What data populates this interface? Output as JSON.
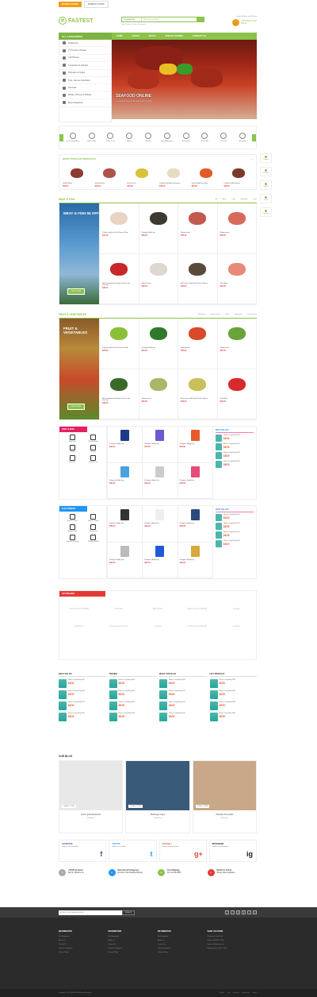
{
  "topbar": {
    "tab1": "MARKET STORE",
    "tab2": "MOMENT STORE"
  },
  "logo": {
    "text": "FASTEST"
  },
  "search": {
    "category": "All categories",
    "placeholder": "Enter the keyword",
    "icon": "search-icon",
    "tags": "Tags: Fashion, Clothes, Electronics"
  },
  "header": {
    "links": "Login  My Account  Wishlist",
    "cart_label": "SHOPPING CART",
    "cart_amount": "$00.00"
  },
  "nav": {
    "categories": "ALL CATEGORIES",
    "items": [
      "HOME",
      "PAGES",
      "DEALS",
      "SPECIAL OFFERS",
      "CONTACT US"
    ]
  },
  "sidebar": [
    "Appliances",
    "TV & Home Theater",
    "Cell Phones",
    "Computers & Laptops",
    "Television & Video",
    "Toys, Games & Hobbies",
    "Cameras",
    "Mobile, Phones & Tablets",
    "More categories"
  ],
  "banner": {
    "title": "SEAFOOD ONLINE",
    "subtitle": "a complete range of all fresh seafood online"
  },
  "categories": [
    "Fruit & Vegetables",
    "Meat & Fish",
    "Drinks & Tea",
    "Bakery",
    "Beauty",
    "Home Appliances",
    "Beverages",
    "Gift & Gifts",
    "Pet Care",
    "Household"
  ],
  "popular": {
    "title": "MOST POPULAR PRODUCTS",
    "items": [
      {
        "name": "Grilled Meat",
        "price": "$40.00",
        "color": "#8d3b2e"
      },
      {
        "name": "Sheep Head",
        "price": "$40.00",
        "color": "#b0514a"
      },
      {
        "name": "Fresh Fruit",
        "price": "$40.00",
        "color": "#d9c33c"
      },
      {
        "name": "Cepbate deletion elemmen",
        "price": "$40.00",
        "color": "#e8dcc0"
      },
      {
        "name": "Dart Deliberacy Brng",
        "price": "$40.00",
        "color": "#e35a2a"
      },
      {
        "name": "Cephate dolorecoron",
        "price": "$40.00",
        "color": "#7a3a2a"
      }
    ]
  },
  "meat": {
    "title": "MEAT & FISH",
    "tabs": [
      "All",
      "Fishes",
      "Crabs",
      "Vegetables",
      "Fruits"
    ],
    "promo_title": "MEAT & FISH 55 OFF",
    "promo_btn": "SHOP NOW",
    "items": [
      {
        "name": "Turkey chicken Fish Pierone Ram",
        "price": "$70.00",
        "color": "#e9d4c4"
      },
      {
        "name": "Pumpkin Baby fry",
        "price": "$40.00",
        "color": "#3d3a32"
      },
      {
        "name": "Sheep meat",
        "price": "$40.00",
        "color": "#c45a4e"
      },
      {
        "name": "Sheep meat",
        "price": "$40.00",
        "color": "#d86a5a"
      },
      {
        "name": "Mal Condintenta Shrimp Three Loop Chicken",
        "price": "$40.00",
        "color": "#c8282a"
      },
      {
        "name": "Sheep meat",
        "price": "$40.00",
        "color": "#ddd8d0"
      },
      {
        "name": "Mal Lurtun Soft Shell Crab Chicken",
        "price": "$40.00",
        "color": "#5a4a3a"
      },
      {
        "name": "Fish Meat",
        "price": "$40.00",
        "color": "#e88a7a"
      }
    ]
  },
  "fruit": {
    "title": "FRUIT & VEGETABLES",
    "tabs": [
      "All Beauty",
      "Uncategorized",
      "Health",
      "Vegetables",
      "Lorem Beauty"
    ],
    "promo_title": "FRUIT & VEGETABLES",
    "promo_btn": "SHOP NOW",
    "items": [
      {
        "name": "Turkey chicken Fish Pierone Ram",
        "price": "$70.00",
        "color": "#8bbf3a"
      },
      {
        "name": "Pumpkin Baby fry",
        "price": "$40.00",
        "color": "#2f7a2a"
      },
      {
        "name": "Sheep meat",
        "price": "$40.00",
        "color": "#d84a2a"
      },
      {
        "name": "Sheep meat",
        "price": "$40.00",
        "color": "#6aa33a"
      },
      {
        "name": "Mal Condintenta Shrimp Three Loop Chicken",
        "price": "$40.00",
        "color": "#3a6a2a"
      },
      {
        "name": "Sheep meat",
        "price": "$40.00",
        "color": "#a8b86a"
      },
      {
        "name": "Mal Lurtun Soft Shell Crab Chicken",
        "price": "$40.00",
        "color": "#c8c05a"
      },
      {
        "name": "Fish Meat",
        "price": "$40.00",
        "color": "#d82a2a"
      }
    ]
  },
  "baby": {
    "title": "BABY & MOM",
    "cats": [
      "Baby Toys",
      "Bath & Shower",
      "Feeding",
      "Nursery",
      "Wearable",
      "Safety & Care"
    ],
    "items": [
      {
        "name": "Pampers Baby Dry",
        "price": "$40.00",
        "color": "#1e3a8a"
      },
      {
        "name": "Pampers Baby Dry",
        "price": "$40.00",
        "color": "#6a5acd"
      },
      {
        "name": "Pampers Baby Dry",
        "price": "$40.00",
        "color": "#e85a2a"
      },
      {
        "name": "Pampers Baby Dry",
        "price": "$40.00",
        "color": "#4aa3df"
      },
      {
        "name": "Pampers Baby Dry",
        "price": "$40.00",
        "color": "#cccccc"
      },
      {
        "name": "Pampers Baby Dry",
        "price": "$40.00",
        "color": "#e84a7a"
      }
    ]
  },
  "best_seller": {
    "title": "BEST SELLER",
    "items": [
      {
        "name": "Fleece Crazy Bling 2013",
        "price": "$40.00"
      },
      {
        "name": "Fleece Crazy Bling 2013",
        "price": "$40.00"
      },
      {
        "name": "Fleece Crazy Bling 2013",
        "price": "$40.00"
      },
      {
        "name": "Fleece Crazy Bling 2013",
        "price": "$40.00"
      }
    ]
  },
  "electronics": {
    "title": "ELECTRONICS",
    "cats": [
      "Audio & Sound",
      "Video & Camera",
      "Mobile & iPad",
      "Accessories",
      "Computer & Laptop",
      "Mobile & Tablet"
    ],
    "items": [
      {
        "name": "Pampers Baby Dry",
        "price": "$40.00",
        "color": "#333333"
      },
      {
        "name": "Pampers Baby Dry",
        "price": "$40.00",
        "color": "#eeeeee"
      },
      {
        "name": "Pampers Baby Dry",
        "price": "$40.00",
        "color": "#2a4a7a"
      },
      {
        "name": "Pampers Baby Dry",
        "price": "$40.00",
        "color": "#bbbbbb"
      },
      {
        "name": "Pampers Baby Dry",
        "price": "$40.00",
        "color": "#1e5ad8"
      },
      {
        "name": "Pampers Baby Dry",
        "price": "$40.00",
        "color": "#d8a83a"
      }
    ]
  },
  "brands": {
    "title": "HOT BRANDS",
    "items": [
      "theProvince BAKE",
      "dribbble",
      "BLOCKS",
      "theProvince BAKE",
      "envato",
      "dribbble",
      "lorempsum Fresh",
      "envato",
      "theProvince BAKE",
      "envato"
    ]
  },
  "lists": [
    {
      "title": "BEST SOLDS",
      "items": [
        {
          "name": "Fleece Crazy Bling 2013",
          "price": "$40.00"
        },
        {
          "name": "Fleece Crazy Bling 2013",
          "price": "$40.00"
        },
        {
          "name": "Fleece Crazy Bling 2013",
          "price": "$40.00"
        },
        {
          "name": "Fleece Crazy Bling 2013",
          "price": "$40.00"
        }
      ]
    },
    {
      "title": "TRENDS",
      "items": [
        {
          "name": "Fleece Crazy Bling 2013",
          "price": "$40.00"
        },
        {
          "name": "Fleece Crazy Bling 2013",
          "price": "$40.00"
        },
        {
          "name": "Fleece Crazy Bling 2013",
          "price": "$40.00"
        },
        {
          "name": "Fleece Crazy Bling 2013",
          "price": "$40.00"
        }
      ]
    },
    {
      "title": "MOST POPULAR",
      "items": [
        {
          "name": "Fleece Crazy Bling 2013",
          "price": "$40.00"
        },
        {
          "name": "Fleece Crazy Bling 2013",
          "price": "$40.00"
        },
        {
          "name": "Fleece Crazy Bling 2013",
          "price": "$40.00"
        },
        {
          "name": "Fleece Crazy Bling 2013",
          "price": "$40.00"
        }
      ]
    },
    {
      "title": "HOT PRODUCT",
      "items": [
        {
          "name": "Fleece Crazy Bling 2013",
          "price": "$40.00"
        },
        {
          "name": "Fleece Crazy Bling 2013",
          "price": "$40.00"
        },
        {
          "name": "Fleece Crazy Bling 2013",
          "price": "$40.00"
        },
        {
          "name": "Fleece Crazy Bling 2013",
          "price": "$40.00"
        }
      ]
    }
  ],
  "blog": {
    "title": "OUR BLOG",
    "posts": [
      {
        "title": "Donec gravida placerat",
        "date": "October 7, 2016",
        "more": "Read more",
        "color": "#e8e8e8"
      },
      {
        "title": "Bleckingar ringue",
        "date": "October 7, 2016",
        "more": "Read more",
        "color": "#3a5a7a"
      },
      {
        "title": "Vulputate frus pelletit",
        "date": "October 7, 2016",
        "more": "Read more",
        "color": "#c8a888"
      }
    ]
  },
  "social": [
    {
      "title": "FACEBOOK",
      "sub": "Follow us on Facebook",
      "icon": "f",
      "color": "#3b5998"
    },
    {
      "title": "TWITTER",
      "sub": "Follow us on Twitter",
      "icon": "t",
      "color": "#1da1f2"
    },
    {
      "title": "GOOGLE +",
      "sub": "Follow us on Facebook",
      "icon": "g+",
      "color": "#dd4b39"
    },
    {
      "title": "INSTAGRAM",
      "sub": "Follow us on Instagram",
      "icon": "ig",
      "color": "#222222"
    }
  ],
  "features": [
    {
      "title": "+35,000 products",
      "sub": "Sports, Medium etc",
      "color": "#aaaaaa"
    },
    {
      "title": "More than 20 Categories",
      "sub": "Discover, Merchandise Brands",
      "color": "#2196f3"
    },
    {
      "title": "Free Shipping",
      "sub": "For all order $99",
      "color": "#8bc34a"
    },
    {
      "title": "Refund in 2 Days",
      "sub": "Money back guarantee",
      "color": "#e53935"
    }
  ],
  "newsletter": {
    "placeholder": "ENTER YOUR EMAIL ADDRESS",
    "button": "SIGN UP",
    "icons": [
      "f",
      "t",
      "g",
      "p",
      "i",
      "y"
    ]
  },
  "footer": [
    {
      "title": "INFORMATION",
      "links": [
        "Site Navigation",
        "About us",
        "Contact Us",
        "Terms & Conditions",
        "Privacy Policy"
      ]
    },
    {
      "title": "INFORMATION",
      "links": [
        "Site Navigation",
        "About us",
        "Contact Us",
        "Terms & Conditions",
        "Privacy Policy"
      ]
    },
    {
      "title": "INFORMATION",
      "links": [
        "Site Navigation",
        "About us",
        "Contact Us",
        "Terms & Conditions",
        "Privacy Policy"
      ]
    },
    {
      "title": "SHOP LOCATION",
      "links": [
        "6th Avenue, New York",
        "Phone: (08) 8800 7700",
        "Email: info@fastest.com",
        "Working Hours: 8:00 - 18:00"
      ]
    }
  ],
  "copyright": {
    "text": "Copyright © 2017  FASTEST. All Rights Reserved.",
    "payments": [
      "PayPal",
      "Visa",
      "Discover",
      "Mastercard",
      "Stripe"
    ]
  },
  "rail": [
    "Compare",
    "Our Store",
    "Wishlist",
    "Call us",
    "Checkout"
  ]
}
